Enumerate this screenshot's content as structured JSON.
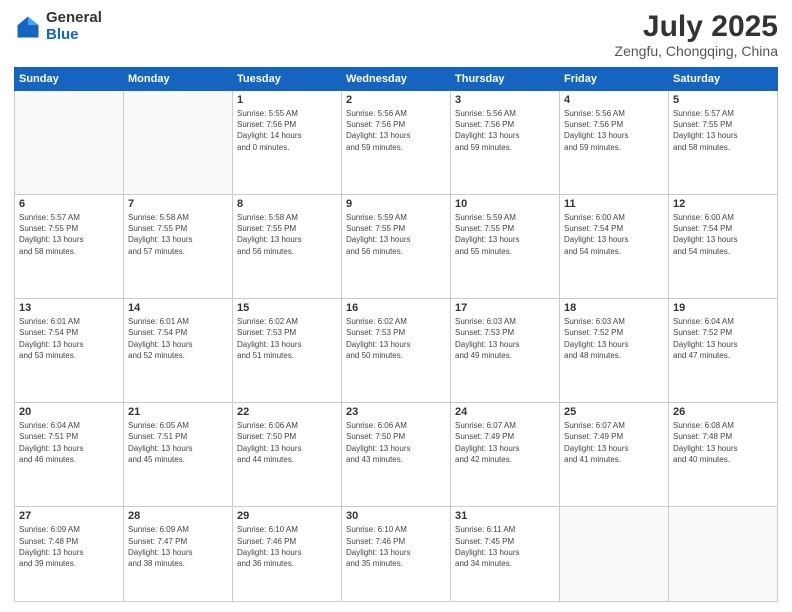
{
  "header": {
    "logo_general": "General",
    "logo_blue": "Blue",
    "month_year": "July 2025",
    "location": "Zengfu, Chongqing, China"
  },
  "weekdays": [
    "Sunday",
    "Monday",
    "Tuesday",
    "Wednesday",
    "Thursday",
    "Friday",
    "Saturday"
  ],
  "weeks": [
    [
      {
        "day": "",
        "info": ""
      },
      {
        "day": "",
        "info": ""
      },
      {
        "day": "1",
        "info": "Sunrise: 5:55 AM\nSunset: 7:56 PM\nDaylight: 14 hours\nand 0 minutes."
      },
      {
        "day": "2",
        "info": "Sunrise: 5:56 AM\nSunset: 7:56 PM\nDaylight: 13 hours\nand 59 minutes."
      },
      {
        "day": "3",
        "info": "Sunrise: 5:56 AM\nSunset: 7:56 PM\nDaylight: 13 hours\nand 59 minutes."
      },
      {
        "day": "4",
        "info": "Sunrise: 5:56 AM\nSunset: 7:56 PM\nDaylight: 13 hours\nand 59 minutes."
      },
      {
        "day": "5",
        "info": "Sunrise: 5:57 AM\nSunset: 7:55 PM\nDaylight: 13 hours\nand 58 minutes."
      }
    ],
    [
      {
        "day": "6",
        "info": "Sunrise: 5:57 AM\nSunset: 7:55 PM\nDaylight: 13 hours\nand 58 minutes."
      },
      {
        "day": "7",
        "info": "Sunrise: 5:58 AM\nSunset: 7:55 PM\nDaylight: 13 hours\nand 57 minutes."
      },
      {
        "day": "8",
        "info": "Sunrise: 5:58 AM\nSunset: 7:55 PM\nDaylight: 13 hours\nand 56 minutes."
      },
      {
        "day": "9",
        "info": "Sunrise: 5:59 AM\nSunset: 7:55 PM\nDaylight: 13 hours\nand 56 minutes."
      },
      {
        "day": "10",
        "info": "Sunrise: 5:59 AM\nSunset: 7:55 PM\nDaylight: 13 hours\nand 55 minutes."
      },
      {
        "day": "11",
        "info": "Sunrise: 6:00 AM\nSunset: 7:54 PM\nDaylight: 13 hours\nand 54 minutes."
      },
      {
        "day": "12",
        "info": "Sunrise: 6:00 AM\nSunset: 7:54 PM\nDaylight: 13 hours\nand 54 minutes."
      }
    ],
    [
      {
        "day": "13",
        "info": "Sunrise: 6:01 AM\nSunset: 7:54 PM\nDaylight: 13 hours\nand 53 minutes."
      },
      {
        "day": "14",
        "info": "Sunrise: 6:01 AM\nSunset: 7:54 PM\nDaylight: 13 hours\nand 52 minutes."
      },
      {
        "day": "15",
        "info": "Sunrise: 6:02 AM\nSunset: 7:53 PM\nDaylight: 13 hours\nand 51 minutes."
      },
      {
        "day": "16",
        "info": "Sunrise: 6:02 AM\nSunset: 7:53 PM\nDaylight: 13 hours\nand 50 minutes."
      },
      {
        "day": "17",
        "info": "Sunrise: 6:03 AM\nSunset: 7:53 PM\nDaylight: 13 hours\nand 49 minutes."
      },
      {
        "day": "18",
        "info": "Sunrise: 6:03 AM\nSunset: 7:52 PM\nDaylight: 13 hours\nand 48 minutes."
      },
      {
        "day": "19",
        "info": "Sunrise: 6:04 AM\nSunset: 7:52 PM\nDaylight: 13 hours\nand 47 minutes."
      }
    ],
    [
      {
        "day": "20",
        "info": "Sunrise: 6:04 AM\nSunset: 7:51 PM\nDaylight: 13 hours\nand 46 minutes."
      },
      {
        "day": "21",
        "info": "Sunrise: 6:05 AM\nSunset: 7:51 PM\nDaylight: 13 hours\nand 45 minutes."
      },
      {
        "day": "22",
        "info": "Sunrise: 6:06 AM\nSunset: 7:50 PM\nDaylight: 13 hours\nand 44 minutes."
      },
      {
        "day": "23",
        "info": "Sunrise: 6:06 AM\nSunset: 7:50 PM\nDaylight: 13 hours\nand 43 minutes."
      },
      {
        "day": "24",
        "info": "Sunrise: 6:07 AM\nSunset: 7:49 PM\nDaylight: 13 hours\nand 42 minutes."
      },
      {
        "day": "25",
        "info": "Sunrise: 6:07 AM\nSunset: 7:49 PM\nDaylight: 13 hours\nand 41 minutes."
      },
      {
        "day": "26",
        "info": "Sunrise: 6:08 AM\nSunset: 7:48 PM\nDaylight: 13 hours\nand 40 minutes."
      }
    ],
    [
      {
        "day": "27",
        "info": "Sunrise: 6:09 AM\nSunset: 7:48 PM\nDaylight: 13 hours\nand 39 minutes."
      },
      {
        "day": "28",
        "info": "Sunrise: 6:09 AM\nSunset: 7:47 PM\nDaylight: 13 hours\nand 38 minutes."
      },
      {
        "day": "29",
        "info": "Sunrise: 6:10 AM\nSunset: 7:46 PM\nDaylight: 13 hours\nand 36 minutes."
      },
      {
        "day": "30",
        "info": "Sunrise: 6:10 AM\nSunset: 7:46 PM\nDaylight: 13 hours\nand 35 minutes."
      },
      {
        "day": "31",
        "info": "Sunrise: 6:11 AM\nSunset: 7:45 PM\nDaylight: 13 hours\nand 34 minutes."
      },
      {
        "day": "",
        "info": ""
      },
      {
        "day": "",
        "info": ""
      }
    ]
  ]
}
